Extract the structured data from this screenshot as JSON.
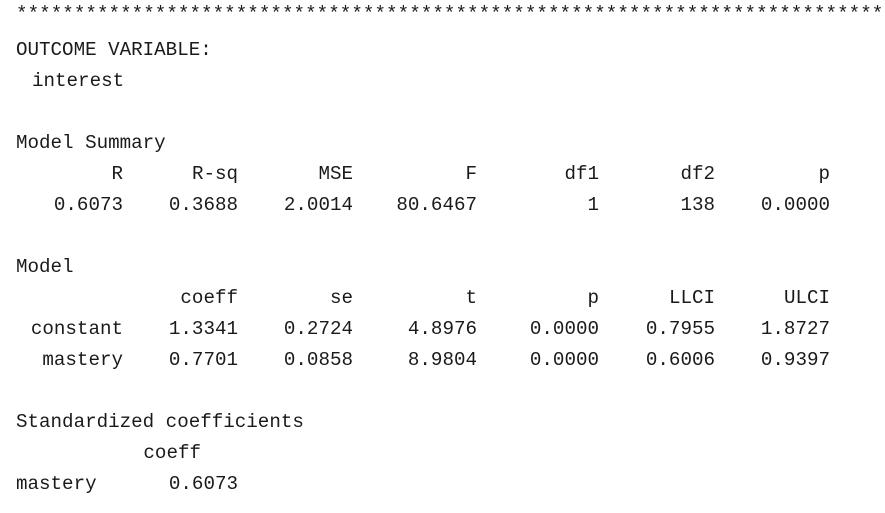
{
  "separator": "***************************************************************************",
  "outcome": {
    "label": "OUTCOME VARIABLE:",
    "variable": "interest"
  },
  "model_summary": {
    "title": "Model Summary",
    "headers": [
      "R",
      "R-sq",
      "MSE",
      "F",
      "df1",
      "df2",
      "p"
    ],
    "values": [
      "0.6073",
      "0.3688",
      "2.0014",
      "80.6467",
      "1",
      "138",
      "0.0000"
    ]
  },
  "model": {
    "title": "Model",
    "headers": [
      "coeff",
      "se",
      "t",
      "p",
      "LLCI",
      "ULCI"
    ],
    "rows": [
      {
        "name": "constant",
        "values": [
          "1.3341",
          "0.2724",
          "4.8976",
          "0.0000",
          "0.7955",
          "1.8727"
        ]
      },
      {
        "name": "mastery",
        "values": [
          "0.7701",
          "0.0858",
          "8.9804",
          "0.0000",
          "0.6006",
          "0.9397"
        ]
      }
    ]
  },
  "standardized": {
    "title": "Standardized coefficients",
    "header": "coeff",
    "row_name": "mastery",
    "value": "0.6073"
  }
}
